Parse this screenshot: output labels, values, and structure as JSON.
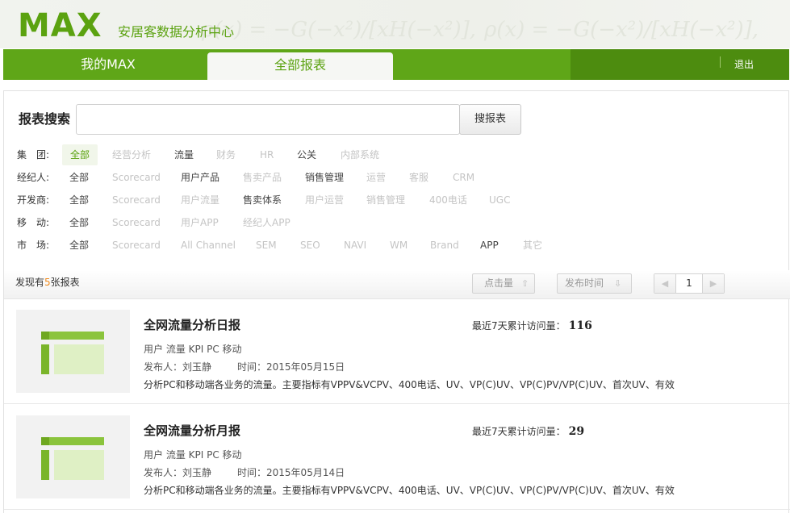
{
  "header": {
    "logo": "MAX",
    "subtitle": "安居客数据分析中心",
    "formula_text": "ρ(x) = −G(−x²)/[xH(−x²)],"
  },
  "nav": {
    "tabs": [
      {
        "label": "我的MAX"
      },
      {
        "label": "全部报表",
        "active": true
      }
    ],
    "logout": "退出"
  },
  "search": {
    "label": "报表搜索",
    "input_value": "",
    "placeholder": "",
    "button": "搜报表"
  },
  "filters": [
    {
      "label": "集　团:",
      "options": [
        "全部",
        "经营分析",
        "流量",
        "财务",
        "HR",
        "公关",
        "内部系统"
      ]
    },
    {
      "label": "经纪人:",
      "options": [
        "全部",
        "Scorecard",
        "用户产品",
        "售卖产品",
        "销售管理",
        "运营",
        "客服",
        "CRM"
      ]
    },
    {
      "label": "开发商:",
      "options": [
        "全部",
        "Scorecard",
        "用户流量",
        "售卖体系",
        "用户运营",
        "销售管理",
        "400电话",
        "UGC"
      ]
    },
    {
      "label": "移　动:",
      "options": [
        "全部",
        "Scorecard",
        "用户APP",
        "经纪人APP"
      ]
    },
    {
      "label": "市　场:",
      "options": [
        "全部",
        "Scorecard",
        "All Channel",
        "SEM",
        "SEO",
        "NAVI",
        "WM",
        "Brand",
        "APP",
        "其它"
      ]
    }
  ],
  "results": {
    "prefix": "发现有",
    "count": "5",
    "suffix": "张报表",
    "sort_clicks": "点击量",
    "sort_date": "发布时间",
    "page": "1"
  },
  "reports": [
    {
      "title": "全网流量分析日报",
      "visits_label": "最近7天累计访问量：",
      "visits": "116",
      "tags": "用户 流量 KPI PC 移动",
      "publisher": "发布人：刘玉静",
      "time": "时间：2015年05月15日",
      "desc": "分析PC和移动端各业务的流量。主要指标有VPPV&VCPV、400电话、UV、VP(C)UV、VP(C)PV/VP(C)UV、首次UV、有效"
    },
    {
      "title": "全网流量分析月报",
      "visits_label": "最近7天累计访问量：",
      "visits": "29",
      "tags": "用户 流量 KPI PC 移动",
      "publisher": "发布人：刘玉静",
      "time": "时间：2015年05月14日",
      "desc": "分析PC和移动端各业务的流量。主要指标有VPPV&VCPV、400电话、UV、VP(C)UV、VP(C)PV/VP(C)UV、首次UV、有效"
    }
  ],
  "colors": {
    "brand_green": "#5fa618",
    "nav_dark": "#4d8c0f",
    "count_orange": "#f08a1c"
  }
}
